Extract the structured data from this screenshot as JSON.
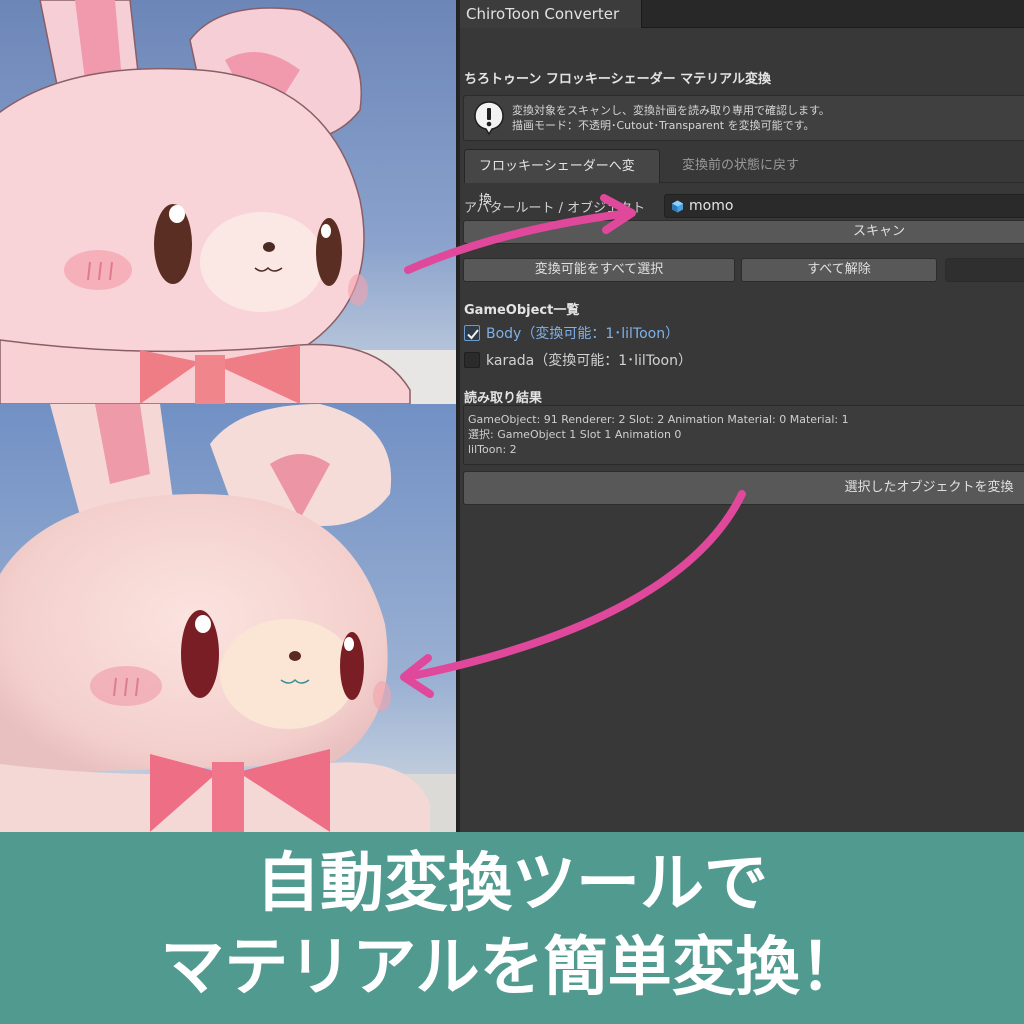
{
  "window": {
    "tab_title": "ChiroToon Converter"
  },
  "header": {
    "title": "ちろトゥーン フロッキーシェーダー マテリアル変換"
  },
  "help": {
    "line1": "変換対象をスキャンし、変換計画を読み取り専用で確認します。",
    "line2": "描画モード：不透明･Cutout･Transparent を変換可能です。"
  },
  "mode_tabs": {
    "active": "フロッキーシェーダーへ変換",
    "inactive": "変換前の状態に戻す"
  },
  "avatar_field": {
    "label": "アバタールート / オブジェクト",
    "value": "momo"
  },
  "buttons": {
    "scan": "スキャン",
    "select_all": "変換可能をすべて選択",
    "clear_all": "すべて解除",
    "convert": "選択したオブジェクトを変換"
  },
  "gameobject_list": {
    "title": "GameObject一覧",
    "items": [
      {
        "label": "Body（変換可能：1･lilToon）",
        "checked": true
      },
      {
        "label": "karada（変換可能：1･lilToon）",
        "checked": false
      }
    ]
  },
  "result": {
    "title": "読み取り結果",
    "lines": [
      "GameObject: 91  Renderer: 2  Slot: 2  Animation Material: 0  Material: 1",
      "選択: GameObject 1  Slot 1  Animation 0",
      "lilToon: 2"
    ]
  },
  "banner": {
    "line1": "自動変換ツールで",
    "line2": "マテリアルを簡単変換！"
  },
  "colors": {
    "banner": "#519a90",
    "arrow": "#e0489b",
    "panel": "#383838",
    "link_blue": "#7fb1e8"
  },
  "icons": {
    "help": "exclamation-bubble-icon",
    "object": "cube-icon",
    "check": "checkmark-icon",
    "arrow": "curved-arrow-icon"
  }
}
